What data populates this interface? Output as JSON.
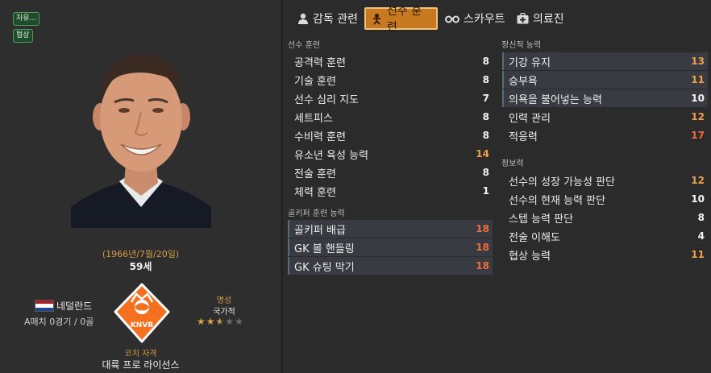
{
  "profile": {
    "badges": [
      "자유...",
      "협상"
    ],
    "dob": "(1966년/7월/20일)",
    "age": "59세",
    "nation": "네덜란드",
    "caps": "A매치 0경기 / 0골",
    "reputation_title": "명성",
    "reputation_value": "국가적",
    "reputation_stars": 2.5,
    "reputation_max": 5,
    "license_title": "코치 자격",
    "license_value": "대륙 프로 라이선스",
    "logo_text": "KNVB"
  },
  "tabs": [
    {
      "label": "감독 관련",
      "icon": "person-icon"
    },
    {
      "label": "선수 훈련",
      "icon": "training-icon",
      "active": true
    },
    {
      "label": "스카우트",
      "icon": "binoculars-icon"
    },
    {
      "label": "의료진",
      "icon": "medical-kit-icon"
    }
  ],
  "sections": {
    "training": {
      "title": "선수 훈련",
      "rows": [
        {
          "label": "공격력 훈련",
          "value": "8"
        },
        {
          "label": "기술 훈련",
          "value": "8"
        },
        {
          "label": "선수 심리 지도",
          "value": "7"
        },
        {
          "label": "세트피스",
          "value": "8"
        },
        {
          "label": "수비력 훈련",
          "value": "8"
        },
        {
          "label": "유소년 육성 능력",
          "value": "14"
        },
        {
          "label": "전술 훈련",
          "value": "8"
        },
        {
          "label": "체력 훈련",
          "value": "1"
        }
      ]
    },
    "goalkeeping": {
      "title": "골키퍼 훈련 능력",
      "rows": [
        {
          "label": "골키퍼 배급",
          "value": "18"
        },
        {
          "label": "GK 볼 핸들링",
          "value": "18"
        },
        {
          "label": "GK 슈팅 막기",
          "value": "18"
        }
      ]
    },
    "mental": {
      "title": "정신적 능력",
      "rows": [
        {
          "label": "기강 유지",
          "value": "13"
        },
        {
          "label": "승부욕",
          "value": "11"
        },
        {
          "label": "의욕을 불어넣는 능력",
          "value": "10"
        },
        {
          "label": "인력 관리",
          "value": "12"
        },
        {
          "label": "적응력",
          "value": "17"
        }
      ]
    },
    "knowledge": {
      "title": "정보력",
      "rows": [
        {
          "label": "선수의 성장 가능성 판단",
          "value": "12"
        },
        {
          "label": "선수의 현재 능력 판단",
          "value": "10"
        },
        {
          "label": "스텝 능력 판단",
          "value": "8"
        },
        {
          "label": "전술 이해도",
          "value": "4"
        },
        {
          "label": "협상 능력",
          "value": "11"
        }
      ]
    }
  },
  "colors": {
    "accent": "#c8781e",
    "value_high": "#f07a3a",
    "value_mid": "#f0a048",
    "value_normal": "#f3f3f3"
  }
}
